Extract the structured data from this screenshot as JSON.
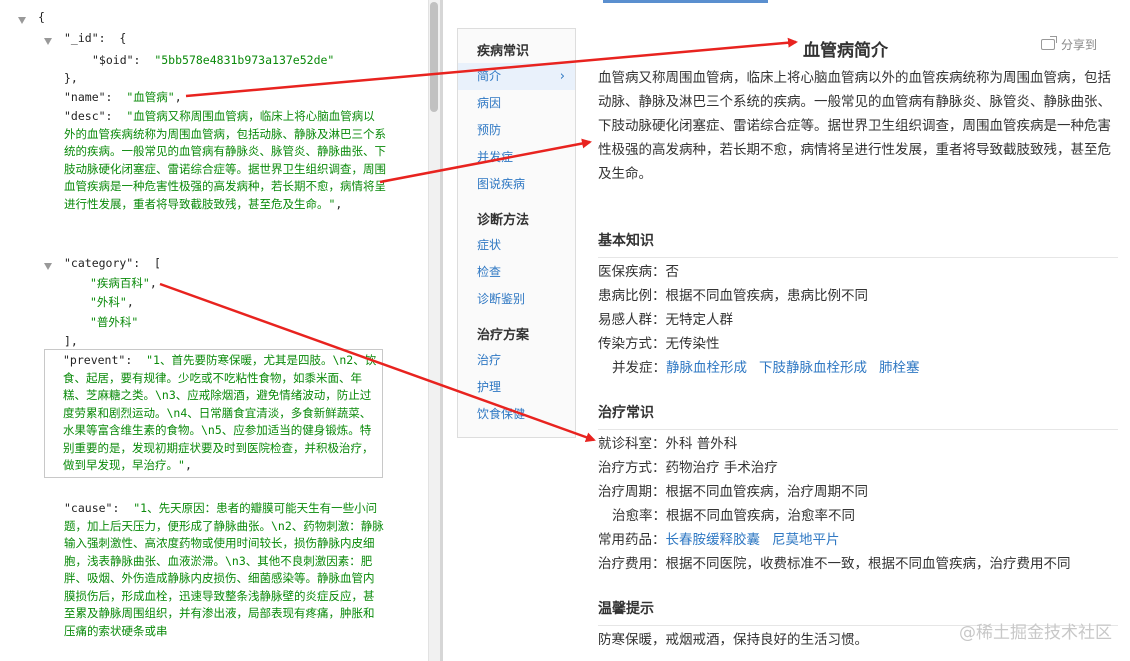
{
  "json_view": {
    "open_brace": "{",
    "id_key": "\"_id\"",
    "oid_key": "\"$oid\"",
    "oid_value": "\"5bb578e4831b973a137e52de\"",
    "name_key": "\"name\"",
    "name_value": "\"血管病\"",
    "desc_key": "\"desc\"",
    "desc_value": "\"血管病又称周围血管病，临床上将心脑血管病以外的血管疾病统称为周围血管病，包括动脉、静脉及淋巴三个系统的疾病。一般常见的血管病有静脉炎、脉管炎、静脉曲张、下肢动脉硬化闭塞症、雷诺综合症等。据世界卫生组织调查，周围血管疾病是一种危害性极强的高发病种，若长期不愈，病情将呈进行性发展，重者将导致截肢致残，甚至危及生命。\"",
    "category_key": "\"category\"",
    "category_items": [
      "\"疾病百科\"",
      "\"外科\"",
      "\"普外科\""
    ],
    "prevent_key": "\"prevent\"",
    "prevent_value": "\"1、首先要防寒保暖，尤其是四肢。\\n2、饮食、起居，要有规律。少吃或不吃粘性食物，如黍米面、年糕、芝麻糖之类。\\n3、应戒除烟酒，避免情绪波动，防止过度劳累和剧烈运动。\\n4、日常膳食宜清淡，多食新鲜蔬菜、水果等富含维生素的食物。\\n5、应参加适当的健身锻炼。特别重要的是，发现初期症状要及时到医院检查，并积极治疗，做到早发现，早治疗。\"",
    "cause_key": "\"cause\"",
    "cause_value": "\"1、先天原因：患者的瓣膜可能天生有一些小问题，加上后天压力，便形成了静脉曲张。\\n2、药物刺激：静脉输入强刺激性、高浓度药物或使用时间较长，损伤静脉内皮细胞，浅表静脉曲张、血液淤滞。\\n3、其他不良刺激因素：肥胖、吸烟、外伤造成静脉内皮损伤、细菌感染等。静脉血管内膜损伤后，形成血栓，迅速导致整条浅静脉壁的炎症反应，甚至累及静脉周围组织，并有渗出液，局部表现有疼痛，肿胀和压痛的索状硬条或串"
  },
  "side_nav": {
    "groups": [
      {
        "title": "疾病常识",
        "items": [
          "简介",
          "病因",
          "预防",
          "并发症",
          "图说疾病"
        ]
      },
      {
        "title": "诊断方法",
        "items": [
          "症状",
          "检查",
          "诊断鉴别"
        ]
      },
      {
        "title": "治疗方案",
        "items": [
          "治疗",
          "护理",
          "饮食保健"
        ]
      }
    ],
    "active_item": "简介"
  },
  "article": {
    "title": "血管病简介",
    "share_label": "分享到",
    "intro": "血管病又称周围血管病，临床上将心脑血管病以外的血管疾病统称为周围血管病，包括动脉、静脉及淋巴三个系统的疾病。一般常见的血管病有静脉炎、脉管炎、静脉曲张、下肢动脉硬化闭塞症、雷诺综合症等。据世界卫生组织调查，周围血管疾病是一种危害性极强的高发病种，若长期不愈，病情将呈进行性发展，重者将导致截肢致残，甚至危及生命。",
    "basic": {
      "title": "基本知识",
      "insurance": "医保疾病：否",
      "ratio": "患病比例：根据不同血管疾病，患病比例不同",
      "susceptible": "易感人群：无特定人群",
      "transmission": "传染方式：无传染性",
      "complication_label": "并发症：",
      "complications": [
        "静脉血栓形成",
        "下肢静脉血栓形成",
        "肺栓塞"
      ]
    },
    "treatment": {
      "title": "治疗常识",
      "department": "就诊科室：外科  普外科",
      "method": "治疗方式：药物治疗  手术治疗",
      "cycle": "治疗周期：根据不同血管疾病，治疗周期不同",
      "cure_rate": "治愈率：根据不同血管疾病，治愈率不同",
      "drugs_label": "常用药品：",
      "drugs": [
        "长春胺缓释胶囊",
        "尼莫地平片"
      ],
      "cost": "治疗费用：根据不同医院，收费标准不一致，根据不同血管疾病，治疗费用不同"
    },
    "tips": {
      "title": "温馨提示",
      "text": "防寒保暖，戒烟戒酒，保持良好的生活习惯。"
    }
  },
  "watermark": "@稀土掘金技术社区",
  "colors": {
    "link": "#2f78c3",
    "json_string": "#0a8a0a",
    "arrow": "#e8231f"
  }
}
